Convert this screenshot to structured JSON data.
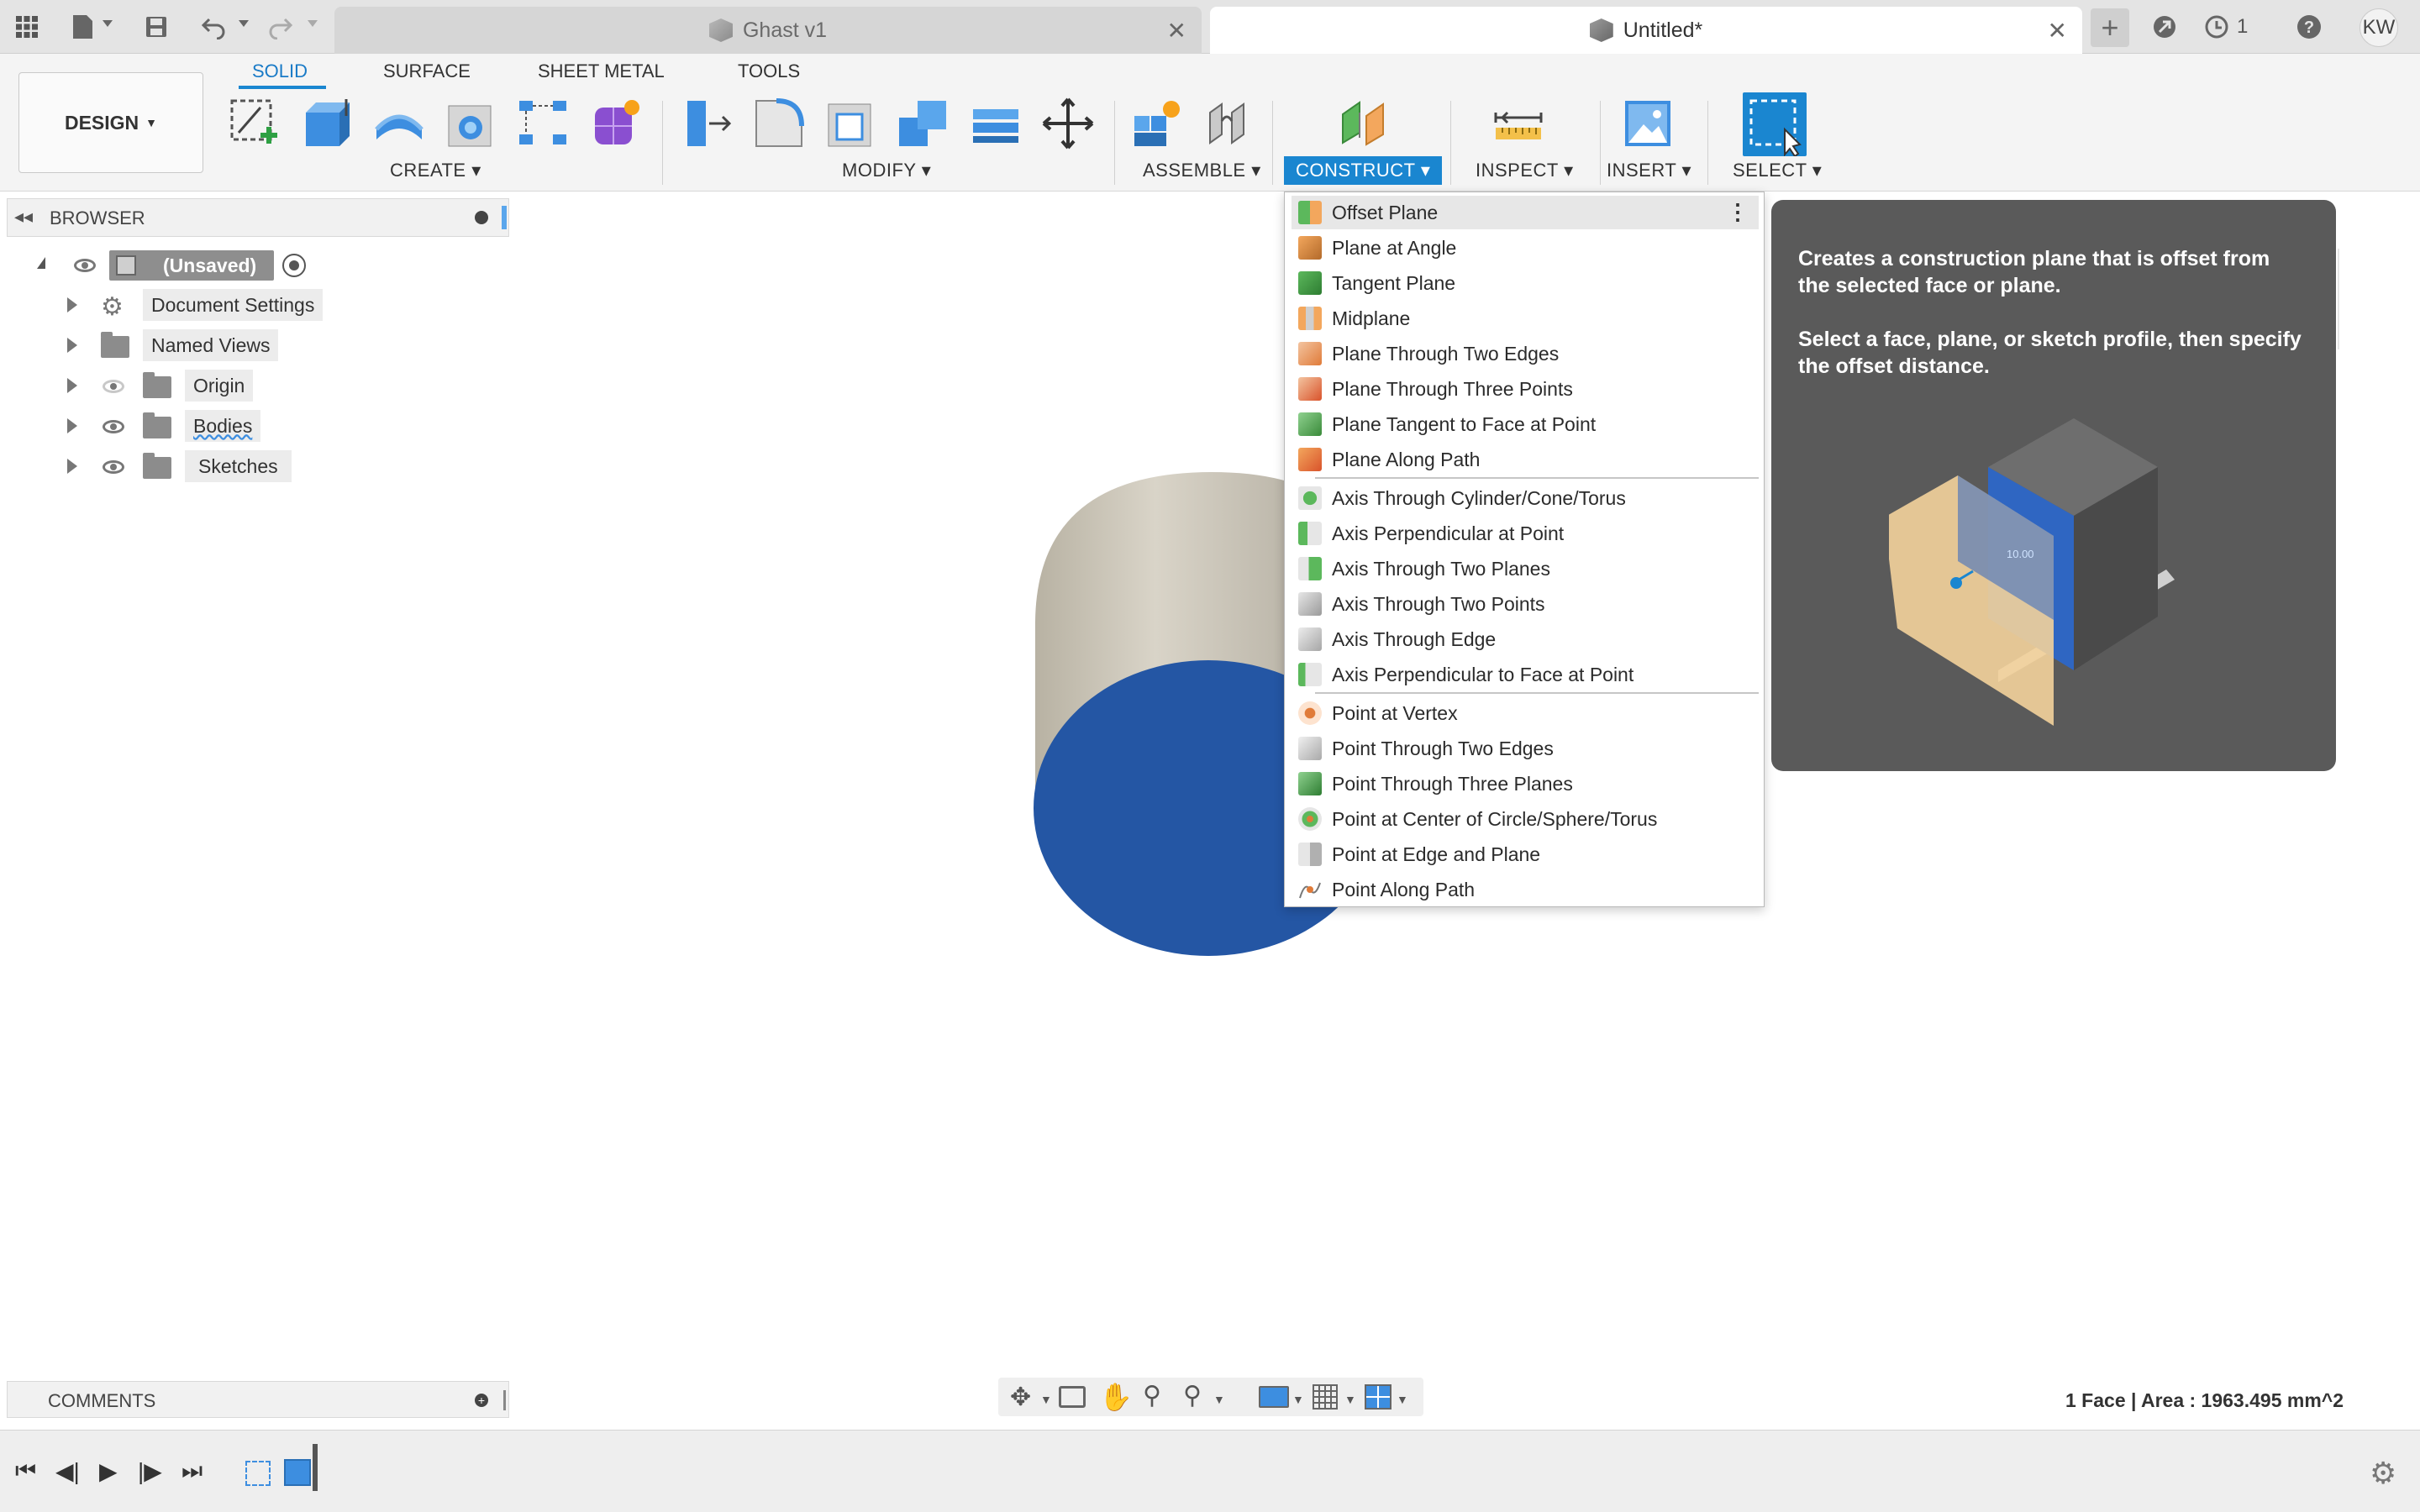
{
  "tabs": {
    "inactive": {
      "title": "Ghast v1"
    },
    "active": {
      "title": "Untitled*"
    }
  },
  "topbar": {
    "job_count": "1",
    "user_initials": "KW"
  },
  "ribbon": {
    "workspace": "DESIGN",
    "tabs": [
      "SOLID",
      "SURFACE",
      "SHEET METAL",
      "TOOLS"
    ],
    "groups": {
      "create": "CREATE",
      "modify": "MODIFY",
      "assemble": "ASSEMBLE",
      "construct": "CONSTRUCT",
      "inspect": "INSPECT",
      "insert": "INSERT",
      "select": "SELECT"
    }
  },
  "browser": {
    "title": "BROWSER",
    "root": "(Unsaved)",
    "items": [
      "Document Settings",
      "Named Views",
      "Origin",
      "Bodies",
      "Sketches"
    ]
  },
  "construct_menu": {
    "planes": [
      "Offset Plane",
      "Plane at Angle",
      "Tangent Plane",
      "Midplane",
      "Plane Through Two Edges",
      "Plane Through Three Points",
      "Plane Tangent to Face at Point",
      "Plane Along Path"
    ],
    "axes": [
      "Axis Through Cylinder/Cone/Torus",
      "Axis Perpendicular at Point",
      "Axis Through Two Planes",
      "Axis Through Two Points",
      "Axis Through Edge",
      "Axis Perpendicular to Face at Point"
    ],
    "points": [
      "Point at Vertex",
      "Point Through Two Edges",
      "Point Through Three Planes",
      "Point at Center of Circle/Sphere/Torus",
      "Point at Edge and Plane",
      "Point Along Path"
    ]
  },
  "tooltip": {
    "line1": "Creates a construction plane that is offset from the selected face or plane.",
    "line2": "Select a face, plane, or sketch profile, then specify the offset distance.",
    "illustration_value": "10.00"
  },
  "comments": {
    "title": "COMMENTS"
  },
  "status": {
    "selection": "1 Face | Area : 1963.495 mm^2"
  },
  "colors": {
    "accent": "#1a86d0",
    "face_blue": "#2456a4",
    "tooltip_bg": "#5a5a5a"
  }
}
